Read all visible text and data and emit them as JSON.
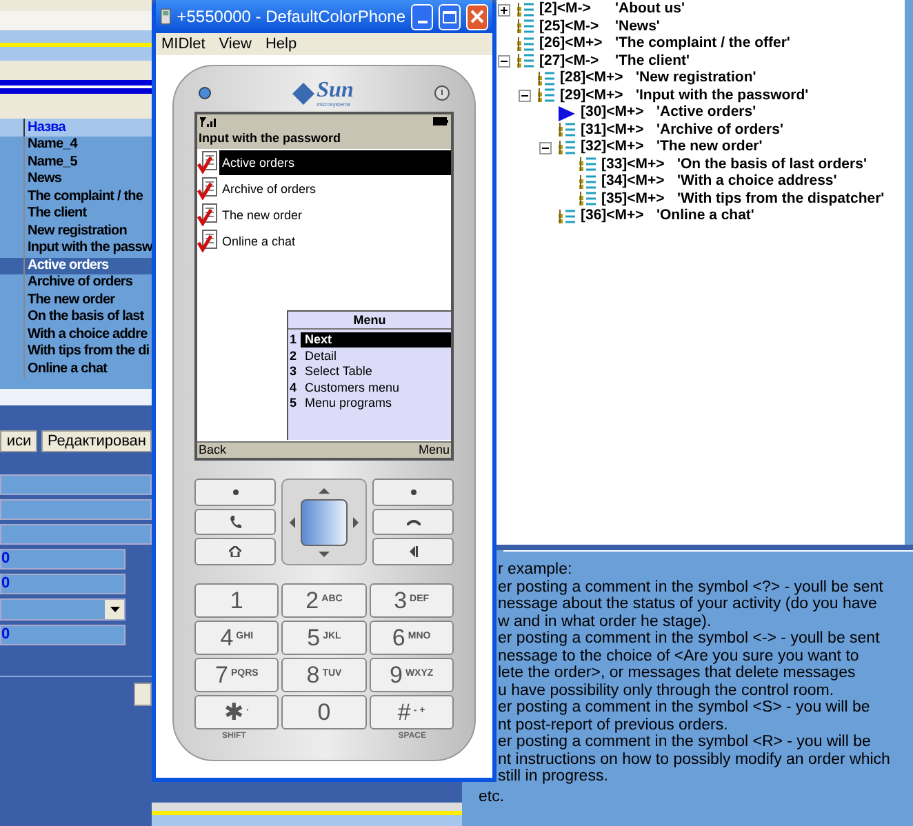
{
  "left_panel": {
    "table": {
      "header": "Назва",
      "rows": [
        {
          "text": "Name_4",
          "selected": false
        },
        {
          "text": "Name_5",
          "selected": false
        },
        {
          "text": "News",
          "selected": false
        },
        {
          "text": "The complaint / the",
          "selected": false
        },
        {
          "text": "The client",
          "selected": false
        },
        {
          "text": "New registration",
          "selected": false
        },
        {
          "text": "Input with the passw",
          "selected": false
        },
        {
          "text": "Active orders",
          "selected": true
        },
        {
          "text": "Archive of orders",
          "selected": false
        },
        {
          "text": "The new order",
          "selected": false
        },
        {
          "text": "On the basis of last",
          "selected": false
        },
        {
          "text": "With a choice addre",
          "selected": false
        },
        {
          "text": "With tips from the di",
          "selected": false
        },
        {
          "text": "Online a chat",
          "selected": false
        }
      ]
    },
    "buttons": [
      "иси",
      "Редактирован"
    ],
    "fields": [
      {
        "kind": "wide"
      },
      {
        "kind": "wide"
      },
      {
        "kind": "wide"
      },
      {
        "kind": "text",
        "value": "0"
      },
      {
        "kind": "text",
        "value": "0"
      },
      {
        "kind": "dropdown"
      },
      {
        "kind": "text",
        "value": "0"
      }
    ]
  },
  "emulator": {
    "title": "+5550000 - DefaultColorPhone",
    "menu": [
      "MIDlet",
      "View",
      "Help"
    ],
    "logo": "Sun",
    "logo_sub": "microsystems",
    "screen": {
      "title": "Input with the password",
      "items": [
        {
          "label": "Active orders",
          "selected": true
        },
        {
          "label": "Archive of orders",
          "selected": false
        },
        {
          "label": "The new order",
          "selected": false
        },
        {
          "label": "Online a chat",
          "selected": false
        }
      ],
      "popup": {
        "title": "Menu",
        "items": [
          {
            "number": "1",
            "label": "Next",
            "selected": true
          },
          {
            "number": "2",
            "label": "Detail",
            "selected": false
          },
          {
            "number": "3",
            "label": "Select Table",
            "selected": false
          },
          {
            "number": "4",
            "label": "Customers menu",
            "selected": false
          },
          {
            "number": "5",
            "label": "Menu programs",
            "selected": false
          }
        ]
      },
      "softkeys": [
        "Back",
        "Menu"
      ]
    },
    "keys": [
      {
        "digit": "1"
      },
      {
        "digit": "2",
        "letters": "ABC"
      },
      {
        "digit": "3",
        "letters": "DEF"
      },
      {
        "digit": "4",
        "letters": "GHI"
      },
      {
        "digit": "5",
        "letters": "JKL"
      },
      {
        "digit": "6",
        "letters": "MNO"
      },
      {
        "digit": "7",
        "letters": "PQRS"
      },
      {
        "digit": "8",
        "letters": "TUV"
      },
      {
        "digit": "9",
        "letters": "WXYZ"
      },
      {
        "digit": "✱",
        "letters": "·"
      },
      {
        "digit": "0"
      },
      {
        "digit": "#",
        "letters": "- +"
      }
    ],
    "key_captions": [
      "SHIFT",
      "SPACE"
    ]
  },
  "tree": [
    {
      "id": "[2]<M->",
      "name": "'About us'",
      "expanded": false,
      "current": false
    },
    {
      "id": "[25]<M->",
      "name": "'News'",
      "current": false
    },
    {
      "id": "[26]<M+>",
      "name": "'The complaint / the offer'",
      "current": false
    },
    {
      "id": "[27]<M->",
      "name": "'The client'",
      "expanded": true,
      "current": false,
      "children": [
        {
          "id": "[28]<M+>",
          "name": "'New registration'",
          "current": false
        },
        {
          "id": "[29]<M+>",
          "name": "'Input with the password'",
          "expanded": true,
          "current": false,
          "children": [
            {
              "id": "[30]<M+>",
              "name": "'Active orders'",
              "current": true
            },
            {
              "id": "[31]<M+>",
              "name": "'Archive of orders'",
              "current": false
            },
            {
              "id": "[32]<M+>",
              "name": "'The new order'",
              "expanded": true,
              "current": false,
              "children": [
                {
                  "id": "[33]<M+>",
                  "name": "'On the basis of last orders'",
                  "current": false
                },
                {
                  "id": "[34]<M+>",
                  "name": "'With a choice address'",
                  "current": false
                },
                {
                  "id": "[35]<M+>",
                  "name": "'With tips from the dispatcher'",
                  "current": false
                }
              ]
            },
            {
              "id": "[36]<M+>",
              "name": "'Online a chat'",
              "current": false
            }
          ]
        }
      ]
    }
  ],
  "help_text": {
    "lines": [
      "r example:",
      "er posting a comment in the symbol <?> - youll be sent",
      "nessage about the status of your activity (do you have",
      "w and in what order he stage).",
      "er posting a comment in the symbol <-> - youll be sent",
      "nessage to the choice of <Are you sure you want to",
      "lete the order>, or messages that delete messages",
      "u have possibility only through the control room.",
      "er posting a comment in the symbol <S> - you will be",
      "nt post-report of previous orders.",
      "er posting a comment in the symbol <R> - you will be",
      "nt instructions on how to possibly modify an order which",
      "still in progress."
    ],
    "last": "etc."
  }
}
